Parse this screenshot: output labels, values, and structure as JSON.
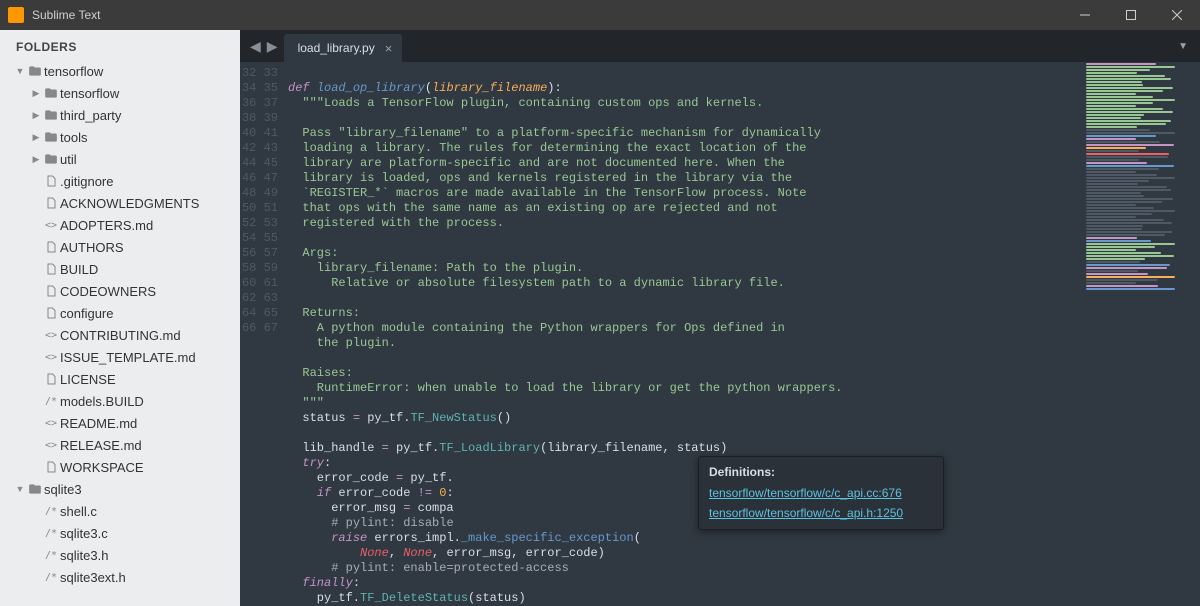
{
  "titlebar": {
    "title": "Sublime Text"
  },
  "sidebar": {
    "header": "FOLDERS",
    "tree": [
      {
        "depth": 0,
        "kind": "folder",
        "open": true,
        "label": "tensorflow"
      },
      {
        "depth": 1,
        "kind": "folder",
        "open": false,
        "label": "tensorflow"
      },
      {
        "depth": 1,
        "kind": "folder",
        "open": false,
        "label": "third_party"
      },
      {
        "depth": 1,
        "kind": "folder",
        "open": false,
        "label": "tools"
      },
      {
        "depth": 1,
        "kind": "folder",
        "open": false,
        "label": "util"
      },
      {
        "depth": 1,
        "kind": "file",
        "icon": "doc",
        "label": ".gitignore"
      },
      {
        "depth": 1,
        "kind": "file",
        "icon": "doc",
        "label": "ACKNOWLEDGMENTS"
      },
      {
        "depth": 1,
        "kind": "file",
        "icon": "md",
        "label": "ADOPTERS.md"
      },
      {
        "depth": 1,
        "kind": "file",
        "icon": "doc",
        "label": "AUTHORS"
      },
      {
        "depth": 1,
        "kind": "file",
        "icon": "doc",
        "label": "BUILD"
      },
      {
        "depth": 1,
        "kind": "file",
        "icon": "doc",
        "label": "CODEOWNERS"
      },
      {
        "depth": 1,
        "kind": "file",
        "icon": "doc",
        "label": "configure"
      },
      {
        "depth": 1,
        "kind": "file",
        "icon": "md",
        "label": "CONTRIBUTING.md"
      },
      {
        "depth": 1,
        "kind": "file",
        "icon": "md",
        "label": "ISSUE_TEMPLATE.md"
      },
      {
        "depth": 1,
        "kind": "file",
        "icon": "doc",
        "label": "LICENSE"
      },
      {
        "depth": 1,
        "kind": "file",
        "icon": "code",
        "label": "models.BUILD"
      },
      {
        "depth": 1,
        "kind": "file",
        "icon": "md",
        "label": "README.md"
      },
      {
        "depth": 1,
        "kind": "file",
        "icon": "md",
        "label": "RELEASE.md"
      },
      {
        "depth": 1,
        "kind": "file",
        "icon": "doc",
        "label": "WORKSPACE"
      },
      {
        "depth": 0,
        "kind": "folder",
        "open": true,
        "label": "sqlite3"
      },
      {
        "depth": 1,
        "kind": "file",
        "icon": "code",
        "label": "shell.c"
      },
      {
        "depth": 1,
        "kind": "file",
        "icon": "code",
        "label": "sqlite3.c"
      },
      {
        "depth": 1,
        "kind": "file",
        "icon": "code",
        "label": "sqlite3.h"
      },
      {
        "depth": 1,
        "kind": "file",
        "icon": "code",
        "label": "sqlite3ext.h"
      }
    ]
  },
  "tab": {
    "label": "load_library.py"
  },
  "gutter": {
    "start": 32,
    "end": 67
  },
  "code": [
    [],
    [
      {
        "c": "kw",
        "t": "def "
      },
      {
        "c": "def",
        "t": "load_op_library"
      },
      {
        "t": "("
      },
      {
        "c": "param",
        "t": "library_filename"
      },
      {
        "t": "):"
      }
    ],
    [
      {
        "t": "  "
      },
      {
        "c": "str",
        "t": "\"\"\"Loads a TensorFlow plugin, containing custom ops and kernels."
      }
    ],
    [],
    [
      {
        "t": "  "
      },
      {
        "c": "str",
        "t": "Pass \"library_filename\" to a platform-specific mechanism for dynamically"
      }
    ],
    [
      {
        "t": "  "
      },
      {
        "c": "str",
        "t": "loading a library. The rules for determining the exact location of the"
      }
    ],
    [
      {
        "t": "  "
      },
      {
        "c": "str",
        "t": "library are platform-specific and are not documented here. When the"
      }
    ],
    [
      {
        "t": "  "
      },
      {
        "c": "str",
        "t": "library is loaded, ops and kernels registered in the library via the"
      }
    ],
    [
      {
        "t": "  "
      },
      {
        "c": "str",
        "t": "`REGISTER_*` macros are made available in the TensorFlow process. Note"
      }
    ],
    [
      {
        "t": "  "
      },
      {
        "c": "str",
        "t": "that ops with the same name as an existing op are rejected and not"
      }
    ],
    [
      {
        "t": "  "
      },
      {
        "c": "str",
        "t": "registered with the process."
      }
    ],
    [],
    [
      {
        "t": "  "
      },
      {
        "c": "str",
        "t": "Args:"
      }
    ],
    [
      {
        "t": "  "
      },
      {
        "c": "str",
        "t": "  library_filename: Path to the plugin."
      }
    ],
    [
      {
        "t": "  "
      },
      {
        "c": "str",
        "t": "    Relative or absolute filesystem path to a dynamic library file."
      }
    ],
    [],
    [
      {
        "t": "  "
      },
      {
        "c": "str",
        "t": "Returns:"
      }
    ],
    [
      {
        "t": "  "
      },
      {
        "c": "str",
        "t": "  A python module containing the Python wrappers for Ops defined in"
      }
    ],
    [
      {
        "t": "  "
      },
      {
        "c": "str",
        "t": "  the plugin."
      }
    ],
    [],
    [
      {
        "t": "  "
      },
      {
        "c": "str",
        "t": "Raises:"
      }
    ],
    [
      {
        "t": "  "
      },
      {
        "c": "str",
        "t": "  RuntimeError: when unable to load the library or get the python wrappers."
      }
    ],
    [
      {
        "t": "  "
      },
      {
        "c": "str",
        "t": "\"\"\""
      }
    ],
    [
      {
        "t": "  status "
      },
      {
        "c": "op",
        "t": "="
      },
      {
        "t": " py_tf."
      },
      {
        "c": "fn",
        "t": "TF_NewStatus"
      },
      {
        "t": "()"
      }
    ],
    [],
    [
      {
        "t": "  lib_handle "
      },
      {
        "c": "op",
        "t": "="
      },
      {
        "t": " py_tf."
      },
      {
        "c": "fn",
        "t": "TF_LoadLibrary"
      },
      {
        "t": "(library_filename, status)"
      }
    ],
    [
      {
        "t": "  "
      },
      {
        "c": "kw",
        "t": "try"
      },
      {
        "t": ":"
      }
    ],
    [
      {
        "t": "    error_code "
      },
      {
        "c": "op",
        "t": "="
      },
      {
        "t": " py_tf."
      }
    ],
    [
      {
        "t": "    "
      },
      {
        "c": "kw",
        "t": "if"
      },
      {
        "t": " error_code "
      },
      {
        "c": "op",
        "t": "!="
      },
      {
        "t": " "
      },
      {
        "c": "num",
        "t": "0"
      },
      {
        "t": ":"
      }
    ],
    [
      {
        "t": "      error_msg "
      },
      {
        "c": "op",
        "t": "="
      },
      {
        "t": " compa"
      }
    ],
    [
      {
        "t": "      "
      },
      {
        "c": "com",
        "t": "# pylint: disable"
      }
    ],
    [
      {
        "t": "      "
      },
      {
        "c": "kw",
        "t": "raise"
      },
      {
        "t": " errors_impl."
      },
      {
        "c": "attr",
        "t": "_make_specific_exception"
      },
      {
        "t": "("
      }
    ],
    [
      {
        "t": "          "
      },
      {
        "c": "const",
        "t": "None"
      },
      {
        "t": ", "
      },
      {
        "c": "const",
        "t": "None"
      },
      {
        "t": ", error_msg, error_code)"
      }
    ],
    [
      {
        "t": "      "
      },
      {
        "c": "com",
        "t": "# pylint: enable=protected-access"
      }
    ],
    [
      {
        "t": "  "
      },
      {
        "c": "kw",
        "t": "finally"
      },
      {
        "t": ":"
      }
    ],
    [
      {
        "t": "    py_tf."
      },
      {
        "c": "fn",
        "t": "TF_DeleteStatus"
      },
      {
        "t": "(status)"
      }
    ]
  ],
  "popup": {
    "title": "Definitions:",
    "links": [
      "tensorflow/tensorflow/c/c_api.cc:676",
      "tensorflow/tensorflow/c/c_api.h:1250"
    ]
  },
  "colors": {
    "bg": "#303841",
    "sidebar": "#ebedef",
    "accent": "#ff9800"
  }
}
